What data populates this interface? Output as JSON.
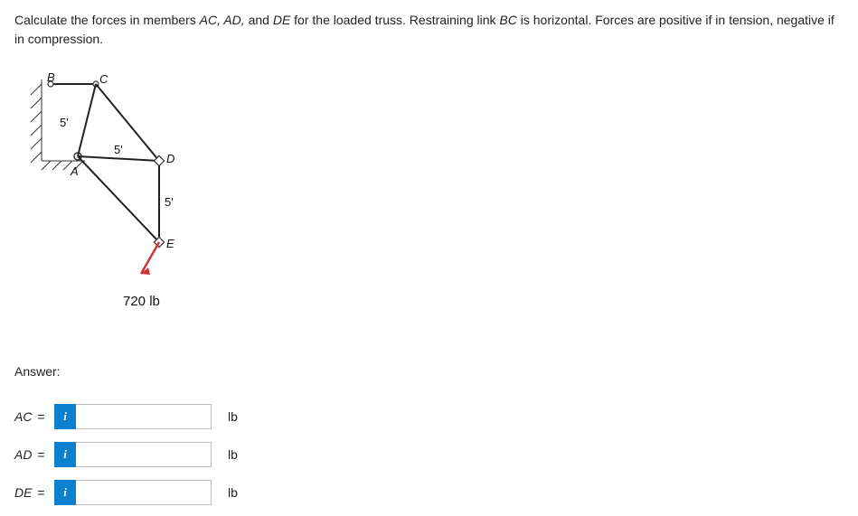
{
  "question": {
    "part1": "Calculate the forces in members ",
    "em1": "AC, AD,",
    "mid": " and ",
    "em2": "DE",
    "part2": " for the loaded truss. Restraining link ",
    "em3": "BC",
    "part3": " is horizontal. Forces are positive if in tension, negative if in compression."
  },
  "figure": {
    "labels": {
      "B": "B",
      "C": "C",
      "A": "A",
      "D": "D",
      "E": "E",
      "dim_BA": "5'",
      "dim_AD": "5'",
      "dim_DE": "5'",
      "load": "720 lb"
    }
  },
  "answer_heading": "Answer:",
  "rows": [
    {
      "label": "AC",
      "eq": "=",
      "info": "i",
      "value": "",
      "unit": "lb"
    },
    {
      "label": "AD",
      "eq": "=",
      "info": "i",
      "value": "",
      "unit": "lb"
    },
    {
      "label": "DE",
      "eq": "=",
      "info": "i",
      "value": "",
      "unit": "lb"
    }
  ]
}
